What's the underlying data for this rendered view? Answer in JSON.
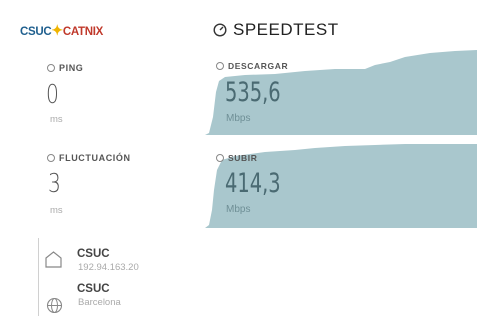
{
  "header": {
    "logo_csuc": "CSUC",
    "logo_catnix": "CATNIX",
    "title": "SPEEDTEST"
  },
  "stats": {
    "ping": {
      "label": "PING",
      "value": "0",
      "unit": "ms"
    },
    "jitter": {
      "label": "FLUCTUACIÓN",
      "value": "3",
      "unit": "ms"
    }
  },
  "download": {
    "label": "DESCARGAR",
    "value": "535,6",
    "unit": "Mbps"
  },
  "upload": {
    "label": "SUBIR",
    "value": "414,3",
    "unit": "Mbps"
  },
  "servers": [
    {
      "name": "CSUC",
      "detail": "192.94.163.20"
    },
    {
      "name": "CSUC",
      "detail": "Barcelona"
    }
  ],
  "colors": {
    "area_fill": "#a9c7cd",
    "logo_blue": "#1f5f8e",
    "logo_red": "#c0392b"
  }
}
